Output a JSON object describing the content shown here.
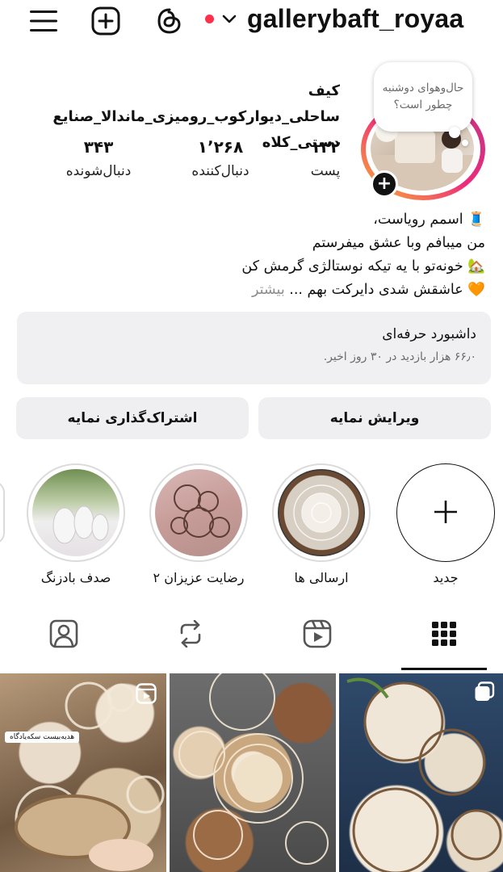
{
  "topbar": {
    "username": "gallerybaft_royaa",
    "icons": [
      "menu-icon",
      "create-icon",
      "threads-icon",
      "chevron-down-icon"
    ],
    "live_dot_color": "#ff2f4a"
  },
  "profile": {
    "note": "حال‌و‌هوای دوشنبه چطور است؟",
    "full_name": "کیف ساحلی_دیوارکوب_رومیزی_ماندالا_صنایع دستی_کلاه",
    "stats": {
      "posts": {
        "value": "۱۳۲",
        "label": "پست"
      },
      "followers": {
        "value": "۱٬۲۶۸",
        "label": "دنبال‌کننده"
      },
      "following": {
        "value": "۳۴۳",
        "label": "دنبال‌شونده"
      }
    },
    "bio_lines": [
      "🧵 اسمم رویاست،",
      "من میبافم وبا عشق میفرستم",
      "🏡 خونه‌تو با یه تیکه نوستالژی گرمش کن",
      "🧡 عاشقش شدی دایرکت بهم ..."
    ],
    "bio_more": "بیشتر"
  },
  "dashboard": {
    "title": "داشبورد حرفه‌ای",
    "subtitle": "۶۶٫۰ هزار بازدید در ۳۰ روز اخیر."
  },
  "buttons": {
    "edit": "ویرایش نمایه",
    "share": "اشتراک‌گذاری نمایه"
  },
  "highlights": [
    {
      "label": "جدید"
    },
    {
      "label": "ارسالی ها"
    },
    {
      "label": "رضایت عزیزان ۲"
    },
    {
      "label": "صدف بادزنگ"
    }
  ],
  "grid": {
    "caption_1": "هدیه‌بیست سکه‌یادگاه"
  }
}
